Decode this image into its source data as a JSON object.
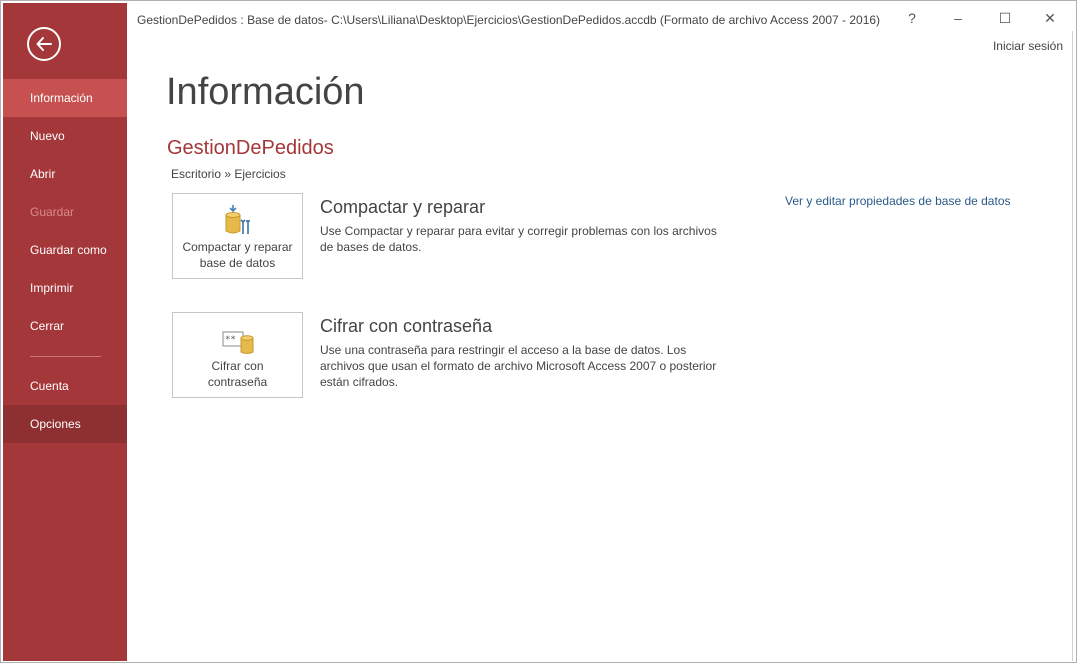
{
  "window": {
    "title": "GestionDePedidos : Base de datos- C:\\Users\\Liliana\\Desktop\\Ejercicios\\GestionDePedidos.accdb (Formato de archivo Access 2007 - 2016) -...",
    "help_label": "?",
    "minimize_label": "–",
    "maximize_label": "☐",
    "close_label": "✕",
    "signin_label": "Iniciar sesión"
  },
  "colors": {
    "sidebar": "#a4373a",
    "sidebar_active": "#c75050",
    "accent_text": "#a4373a",
    "link": "#2a5a8a"
  },
  "sidebar": {
    "back_icon": "back-arrow-icon",
    "items": [
      {
        "label": "Información",
        "state": "active"
      },
      {
        "label": "Nuevo",
        "state": "normal"
      },
      {
        "label": "Abrir",
        "state": "normal"
      },
      {
        "label": "Guardar",
        "state": "disabled"
      },
      {
        "label": "Guardar como",
        "state": "normal"
      },
      {
        "label": "Imprimir",
        "state": "normal"
      },
      {
        "label": "Cerrar",
        "state": "normal"
      },
      {
        "label": "Cuenta",
        "state": "normal"
      },
      {
        "label": "Opciones",
        "state": "hover"
      }
    ]
  },
  "main": {
    "title": "Información",
    "db_name": "GestionDePedidos",
    "breadcrumb": "Escritorio » Ejercicios",
    "properties_link": "Ver y editar propiedades de base de datos",
    "sections": [
      {
        "tile_label": "Compactar y reparar\nbase de datos",
        "tile_icon": "compact-repair-database-icon",
        "title": "Compactar y reparar",
        "description": "Use Compactar y reparar para evitar y corregir problemas con los archivos de bases de datos."
      },
      {
        "tile_label": "Cifrar con\ncontraseña",
        "tile_icon": "encrypt-password-database-icon",
        "title": "Cifrar con contraseña",
        "description": "Use una contraseña para restringir el acceso a la base de datos. Los archivos que usan el formato de archivo Microsoft Access 2007 o posterior están cifrados."
      }
    ]
  }
}
